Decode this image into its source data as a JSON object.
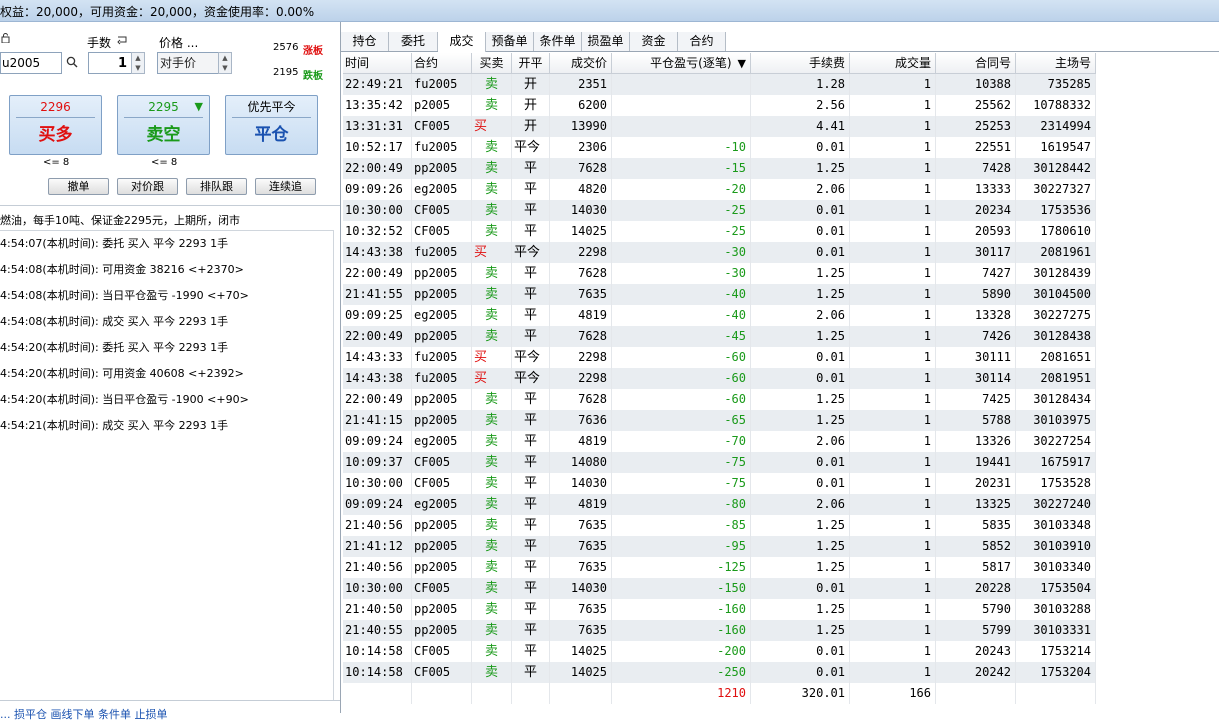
{
  "status_bar": {
    "text": "权益：20,000，可用资金：20,000，资金使用率：0.00%"
  },
  "order_panel": {
    "lock_icon": "lock-icon",
    "lots_label": "手数",
    "price_label": "价格 ...",
    "symbol_value": "u2005",
    "lots_value": "1",
    "price_mode": "对手价",
    "limit_up_price": "2576",
    "limit_up_label": "涨板",
    "limit_down_price": "2195",
    "limit_down_label": "跌板",
    "buy_button": {
      "price": "2296",
      "label": "买多",
      "constraint": "<= 8"
    },
    "sell_button": {
      "price": "2295",
      "label": "卖空",
      "constraint": "<= 8"
    },
    "close_button": {
      "top": "优先平今",
      "label": "平仓"
    },
    "actions": [
      "撤单",
      "对价跟",
      "排队跟",
      "连续追"
    ],
    "contract_info": "燃油，每手10吨、保证金2295元，上期所，闭市",
    "log": [
      "4:54:07(本机时间): 委托  买入  平今  2293  1手",
      "4:54:08(本机时间): 可用资金 38216  <+2370>",
      "4:54:08(本机时间): 当日平仓盈亏 -1990  <+70>",
      "4:54:08(本机时间): 成交  买入  平今  2293  1手",
      "4:54:20(本机时间): 委托  买入  平今  2293  1手",
      "4:54:20(本机时间): 可用资金 40608  <+2392>",
      "4:54:20(本机时间): 当日平仓盈亏 -1900  <+90>",
      "4:54:21(本机时间): 成交  买入  平今  2293  1手"
    ],
    "footer_partial": "... 损平仓    画线下单    条件单    止损单"
  },
  "tabs": [
    "持仓",
    "委托",
    "成交",
    "预备单",
    "条件单",
    "损盈单",
    "资金",
    "合约"
  ],
  "active_tab": "成交",
  "table": {
    "columns": [
      "时间",
      "合约",
      "买卖",
      "开平",
      "成交价",
      "平仓盈亏(逐笔)",
      "手续费",
      "成交量",
      "合同号",
      "主场号"
    ],
    "sort_indicator": "▼",
    "rows": [
      [
        "22:49:21",
        "fu2005",
        "卖",
        "开",
        "2351",
        "",
        "1.28",
        "1",
        "10388",
        "735285"
      ],
      [
        "13:35:42",
        "p2005",
        "卖",
        "开",
        "6200",
        "",
        "2.56",
        "1",
        "25562",
        "10788332"
      ],
      [
        "13:31:31",
        "CF005",
        "买",
        "开",
        "13990",
        "",
        "4.41",
        "1",
        "25253",
        "2314994"
      ],
      [
        "10:52:17",
        "fu2005",
        "卖",
        "平今",
        "2306",
        "-10",
        "0.01",
        "1",
        "22551",
        "1619547"
      ],
      [
        "22:00:49",
        "pp2005",
        "卖",
        "平",
        "7628",
        "-15",
        "1.25",
        "1",
        "7428",
        "30128442"
      ],
      [
        "09:09:26",
        "eg2005",
        "卖",
        "平",
        "4820",
        "-20",
        "2.06",
        "1",
        "13333",
        "30227327"
      ],
      [
        "10:30:00",
        "CF005",
        "卖",
        "平",
        "14030",
        "-25",
        "0.01",
        "1",
        "20234",
        "1753536"
      ],
      [
        "10:32:52",
        "CF005",
        "卖",
        "平",
        "14025",
        "-25",
        "0.01",
        "1",
        "20593",
        "1780610"
      ],
      [
        "14:43:38",
        "fu2005",
        "买",
        "平今",
        "2298",
        "-30",
        "0.01",
        "1",
        "30117",
        "2081961"
      ],
      [
        "22:00:49",
        "pp2005",
        "卖",
        "平",
        "7628",
        "-30",
        "1.25",
        "1",
        "7427",
        "30128439"
      ],
      [
        "21:41:55",
        "pp2005",
        "卖",
        "平",
        "7635",
        "-40",
        "1.25",
        "1",
        "5890",
        "30104500"
      ],
      [
        "09:09:25",
        "eg2005",
        "卖",
        "平",
        "4819",
        "-40",
        "2.06",
        "1",
        "13328",
        "30227275"
      ],
      [
        "22:00:49",
        "pp2005",
        "卖",
        "平",
        "7628",
        "-45",
        "1.25",
        "1",
        "7426",
        "30128438"
      ],
      [
        "14:43:33",
        "fu2005",
        "买",
        "平今",
        "2298",
        "-60",
        "0.01",
        "1",
        "30111",
        "2081651"
      ],
      [
        "14:43:38",
        "fu2005",
        "买",
        "平今",
        "2298",
        "-60",
        "0.01",
        "1",
        "30114",
        "2081951"
      ],
      [
        "22:00:49",
        "pp2005",
        "卖",
        "平",
        "7628",
        "-60",
        "1.25",
        "1",
        "7425",
        "30128434"
      ],
      [
        "21:41:15",
        "pp2005",
        "卖",
        "平",
        "7636",
        "-65",
        "1.25",
        "1",
        "5788",
        "30103975"
      ],
      [
        "09:09:24",
        "eg2005",
        "卖",
        "平",
        "4819",
        "-70",
        "2.06",
        "1",
        "13326",
        "30227254"
      ],
      [
        "10:09:37",
        "CF005",
        "卖",
        "平",
        "14080",
        "-75",
        "0.01",
        "1",
        "19441",
        "1675917"
      ],
      [
        "10:30:00",
        "CF005",
        "卖",
        "平",
        "14030",
        "-75",
        "0.01",
        "1",
        "20231",
        "1753528"
      ],
      [
        "09:09:24",
        "eg2005",
        "卖",
        "平",
        "4819",
        "-80",
        "2.06",
        "1",
        "13325",
        "30227240"
      ],
      [
        "21:40:56",
        "pp2005",
        "卖",
        "平",
        "7635",
        "-85",
        "1.25",
        "1",
        "5835",
        "30103348"
      ],
      [
        "21:41:12",
        "pp2005",
        "卖",
        "平",
        "7635",
        "-95",
        "1.25",
        "1",
        "5852",
        "30103910"
      ],
      [
        "21:40:56",
        "pp2005",
        "卖",
        "平",
        "7635",
        "-125",
        "1.25",
        "1",
        "5817",
        "30103340"
      ],
      [
        "10:30:00",
        "CF005",
        "卖",
        "平",
        "14030",
        "-150",
        "0.01",
        "1",
        "20228",
        "1753504"
      ],
      [
        "21:40:50",
        "pp2005",
        "卖",
        "平",
        "7635",
        "-160",
        "1.25",
        "1",
        "5790",
        "30103288"
      ],
      [
        "21:40:55",
        "pp2005",
        "卖",
        "平",
        "7635",
        "-160",
        "1.25",
        "1",
        "5799",
        "30103331"
      ],
      [
        "10:14:58",
        "CF005",
        "卖",
        "平",
        "14025",
        "-200",
        "0.01",
        "1",
        "20243",
        "1753214"
      ],
      [
        "10:14:58",
        "CF005",
        "卖",
        "平",
        "14025",
        "-250",
        "0.01",
        "1",
        "20242",
        "1753204"
      ]
    ],
    "totals": {
      "pnl": "1210",
      "fee": "320.01",
      "volume": "166"
    }
  },
  "colors": {
    "buy": "#e01010",
    "sell": "#1a9a1a",
    "row_alt": "#e9edf1",
    "topbar": "#c8dbef"
  }
}
